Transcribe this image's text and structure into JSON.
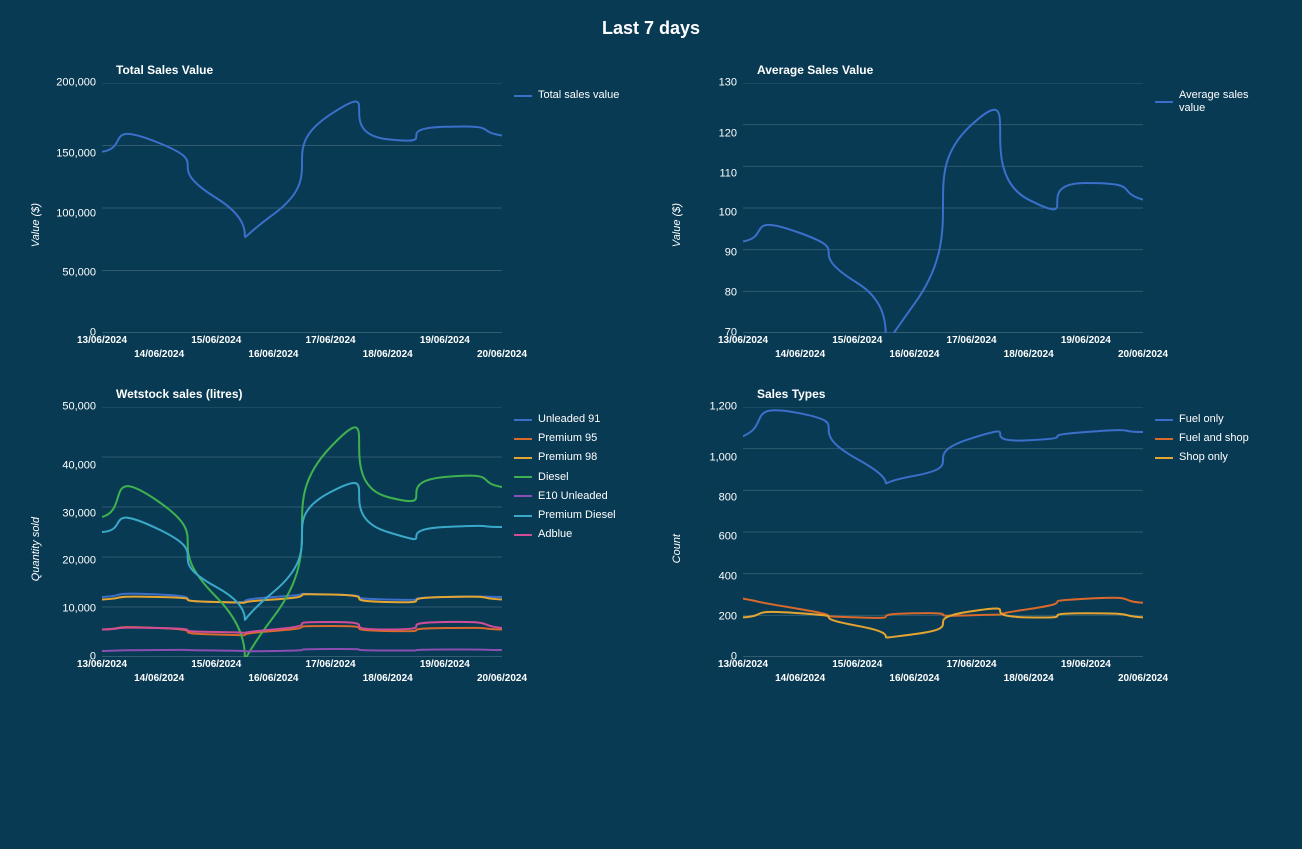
{
  "page_title": "Last 7 days",
  "chart_data": [
    {
      "id": "total_sales",
      "type": "line",
      "title": "Total Sales Value",
      "ylabel": "Value ($)",
      "xlabel": "",
      "categories": [
        "13/06/2024",
        "14/06/2024",
        "15/06/2024",
        "16/06/2024",
        "17/06/2024",
        "18/06/2024",
        "19/06/2024",
        "20/06/2024"
      ],
      "y_ticks": [
        "200,000",
        "150,000",
        "100,000",
        "50,000",
        "0"
      ],
      "ylim": [
        0,
        200000
      ],
      "series": [
        {
          "name": "Total sales value",
          "color": "#3b6fc9",
          "values": [
            145000,
            152000,
            108000,
            95000,
            175000,
            155000,
            165000,
            158000
          ]
        }
      ]
    },
    {
      "id": "avg_sales",
      "type": "line",
      "title": "Average Sales Value",
      "ylabel": "Value ($)",
      "xlabel": "",
      "categories": [
        "13/06/2024",
        "14/06/2024",
        "15/06/2024",
        "16/06/2024",
        "17/06/2024",
        "18/06/2024",
        "19/06/2024",
        "20/06/2024"
      ],
      "y_ticks": [
        "130",
        "120",
        "110",
        "100",
        "90",
        "80",
        "70"
      ],
      "ylim": [
        70,
        130
      ],
      "series": [
        {
          "name": "Average sales value",
          "color": "#3b6fc9",
          "values": [
            92,
            94,
            82,
            77,
            120,
            102,
            106,
            102
          ]
        }
      ]
    },
    {
      "id": "wetstock",
      "type": "line",
      "title": "Wetstock sales (litres)",
      "ylabel": "Quantity sold",
      "xlabel": "",
      "categories": [
        "13/06/2024",
        "14/06/2024",
        "15/06/2024",
        "16/06/2024",
        "17/06/2024",
        "18/06/2024",
        "19/06/2024",
        "20/06/2024"
      ],
      "y_ticks": [
        "50,000",
        "40,000",
        "30,000",
        "20,000",
        "10,000",
        "0"
      ],
      "ylim": [
        0,
        50000
      ],
      "series": [
        {
          "name": "Unleaded 91",
          "color": "#3b6fc9",
          "values": [
            12000,
            12500,
            11000,
            12000,
            12500,
            11500,
            12000,
            12000
          ]
        },
        {
          "name": "Premium 95",
          "color": "#d96a2b",
          "values": [
            5500,
            5800,
            4500,
            5200,
            6200,
            5200,
            5800,
            5500
          ]
        },
        {
          "name": "Premium 98",
          "color": "#e6a531",
          "values": [
            11500,
            12000,
            11000,
            11500,
            12500,
            11000,
            12000,
            11500
          ]
        },
        {
          "name": "Diesel",
          "color": "#3fb24f",
          "values": [
            28000,
            31000,
            12000,
            8000,
            42000,
            32000,
            36000,
            34000
          ]
        },
        {
          "name": "E10 Unleaded",
          "color": "#8a4fb2",
          "values": [
            1200,
            1400,
            1300,
            1200,
            1600,
            1300,
            1500,
            1400
          ]
        },
        {
          "name": "Premium Diesel",
          "color": "#3aa9c9",
          "values": [
            25000,
            25500,
            14000,
            13000,
            33000,
            25000,
            26000,
            26000
          ]
        },
        {
          "name": "Adblue",
          "color": "#d14d98",
          "values": [
            5500,
            5800,
            5000,
            5500,
            7000,
            5500,
            7000,
            5800
          ]
        }
      ]
    },
    {
      "id": "sales_types",
      "type": "line",
      "title": "Sales Types",
      "ylabel": "Count",
      "xlabel": "",
      "categories": [
        "13/06/2024",
        "14/06/2024",
        "15/06/2024",
        "16/06/2024",
        "17/06/2024",
        "18/06/2024",
        "19/06/2024",
        "20/06/2024"
      ],
      "y_ticks": [
        "1,200",
        "1,000",
        "800",
        "600",
        "400",
        "200",
        "0"
      ],
      "ylim": [
        0,
        1200
      ],
      "series": [
        {
          "name": "Fuel only",
          "color": "#3b6fc9",
          "values": [
            1060,
            1170,
            950,
            870,
            1050,
            1040,
            1080,
            1080
          ]
        },
        {
          "name": "Fuel and shop",
          "color": "#d96a2b",
          "values": [
            280,
            230,
            190,
            210,
            200,
            230,
            280,
            260
          ]
        },
        {
          "name": "Shop only",
          "color": "#e6a531",
          "values": [
            190,
            210,
            150,
            110,
            220,
            190,
            210,
            190
          ]
        }
      ]
    }
  ]
}
